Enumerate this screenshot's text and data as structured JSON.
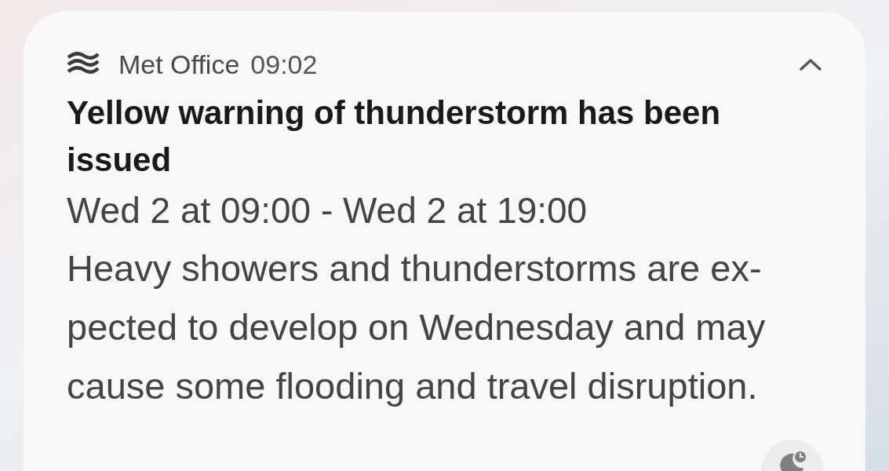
{
  "notification": {
    "app_name": "Met Office",
    "time": "09:02",
    "expanded": true,
    "title": "Yellow warning of thunderstorm has been issued",
    "period": "Wed 2 at 09:00 - Wed 2 at 19:00",
    "body": "Heavy showers and thunderstorms are ex-pected to develop on Wednesday and may cause some flooding and travel disruption."
  }
}
